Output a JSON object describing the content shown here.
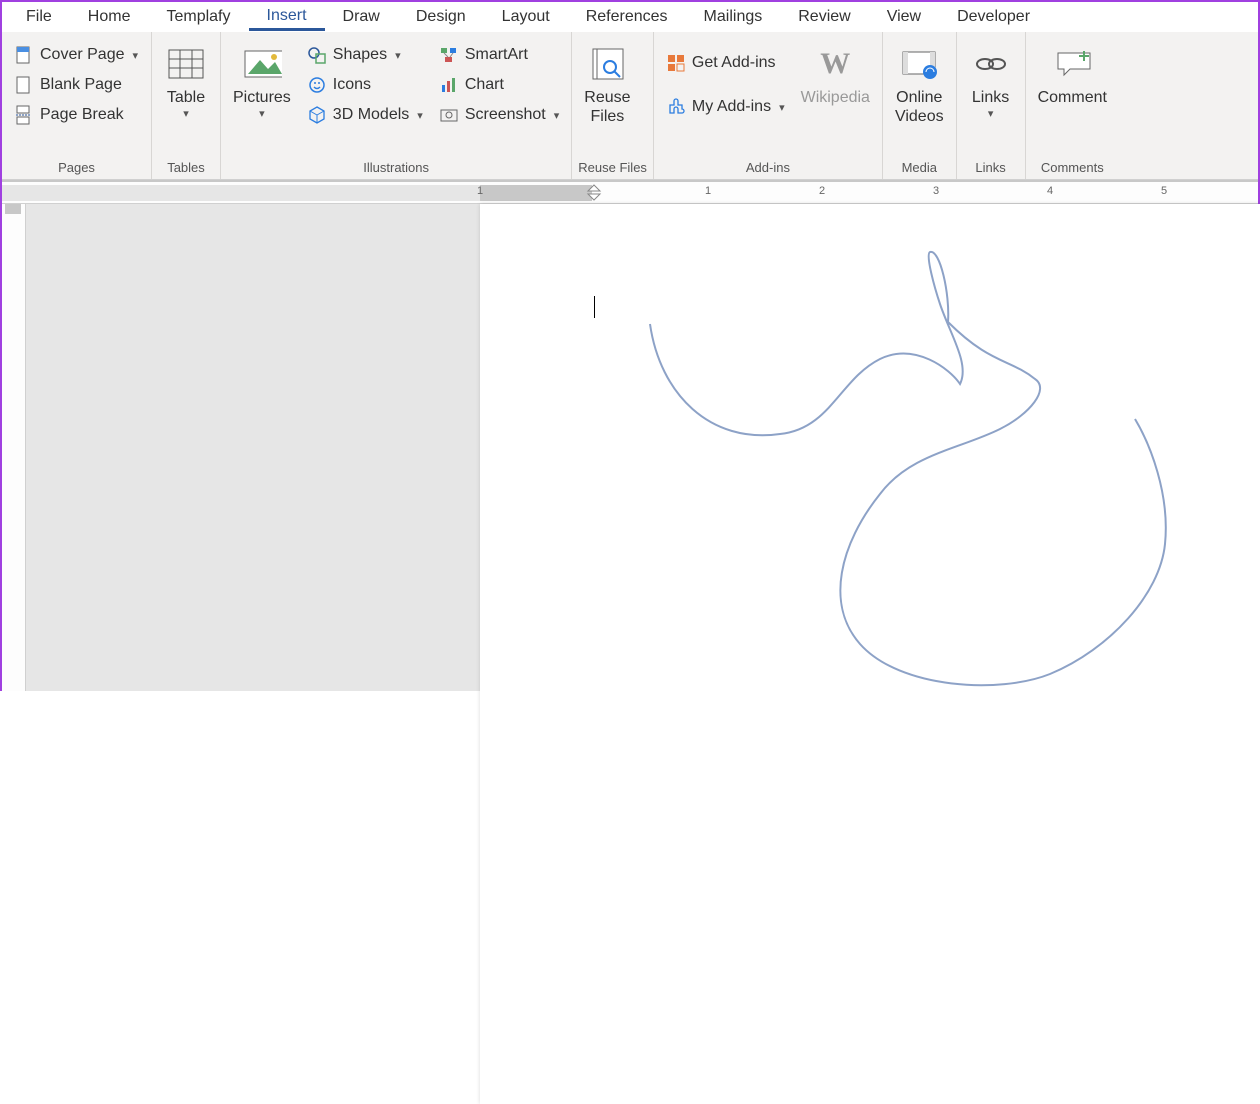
{
  "tabs": {
    "file": "File",
    "home": "Home",
    "templafy": "Templafy",
    "insert": "Insert",
    "draw": "Draw",
    "design": "Design",
    "layout": "Layout",
    "references": "References",
    "mailings": "Mailings",
    "review": "Review",
    "view": "View",
    "developer": "Developer"
  },
  "ribbon": {
    "pages": {
      "label": "Pages",
      "cover_page": "Cover Page",
      "blank_page": "Blank Page",
      "page_break": "Page Break"
    },
    "tables": {
      "label": "Tables",
      "table": "Table"
    },
    "illustrations": {
      "label": "Illustrations",
      "pictures": "Pictures",
      "shapes": "Shapes",
      "icons": "Icons",
      "models3d": "3D Models",
      "smartart": "SmartArt",
      "chart": "Chart",
      "screenshot": "Screenshot"
    },
    "reuse": {
      "label": "Reuse Files",
      "reuse_files": "Reuse\nFiles"
    },
    "addins": {
      "label": "Add-ins",
      "get": "Get Add-ins",
      "my": "My Add-ins",
      "wikipedia": "Wikipedia"
    },
    "media": {
      "label": "Media",
      "online_videos": "Online\nVideos"
    },
    "links": {
      "label": "Links",
      "links": "Links"
    },
    "comments": {
      "label": "Comments",
      "comment": "Comment"
    }
  },
  "ruler": {
    "numbers": [
      "1",
      "1",
      "2",
      "3",
      "4",
      "5"
    ]
  }
}
